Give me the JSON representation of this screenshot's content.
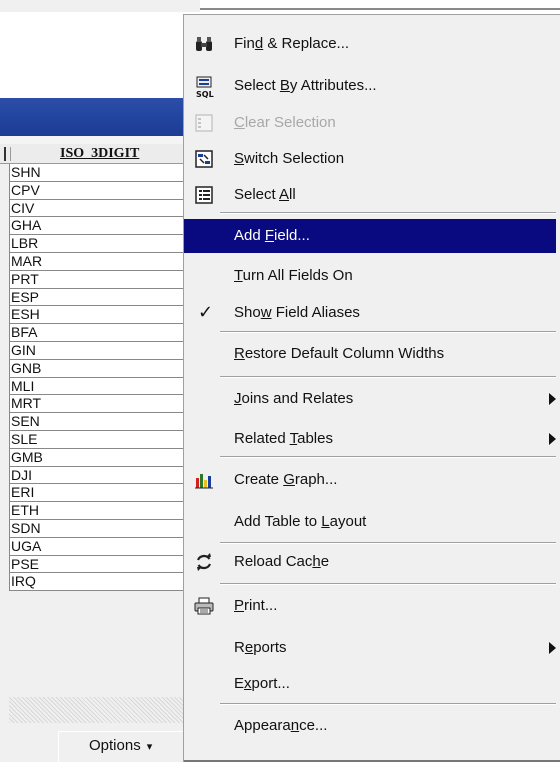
{
  "table": {
    "column_header": "ISO_3DIGIT",
    "rows": [
      "SHN",
      "CPV",
      "CIV",
      "GHA",
      "LBR",
      "MAR",
      "PRT",
      "ESP",
      "ESH",
      "BFA",
      "GIN",
      "GNB",
      "MLI",
      "MRT",
      "SEN",
      "SLE",
      "GMB",
      "DJI",
      "ERI",
      "ETH",
      "SDN",
      "UGA",
      "PSE",
      "IRQ"
    ],
    "options_label": "Options",
    "options_arrow": "▾"
  },
  "menu": {
    "find_replace": {
      "pre": "Fin",
      "key": "d",
      "post": " & Replace..."
    },
    "select_by_attributes": {
      "pre": "Select ",
      "key": "B",
      "post": "y Attributes..."
    },
    "clear_selection": {
      "pre": "",
      "key": "C",
      "post": "lear Selection"
    },
    "switch_selection": {
      "pre": "",
      "key": "S",
      "post": "witch Selection"
    },
    "select_all": {
      "pre": "Select ",
      "key": "A",
      "post": "ll"
    },
    "add_field": {
      "pre": "Add ",
      "key": "F",
      "post": "ield..."
    },
    "turn_all_fields_on": {
      "pre": "",
      "key": "T",
      "post": "urn All Fields On"
    },
    "show_field_aliases": {
      "pre": "Sho",
      "key": "w",
      "post": " Field Aliases"
    },
    "restore_column_widths": {
      "pre": "",
      "key": "R",
      "post": "estore Default Column Widths"
    },
    "joins_and_relates": {
      "pre": "",
      "key": "J",
      "post": "oins and Relates"
    },
    "related_tables": {
      "pre": "Related ",
      "key": "T",
      "post": "ables"
    },
    "create_graph": {
      "pre": "Create ",
      "key": "G",
      "post": "raph..."
    },
    "add_table_to_layout": {
      "pre": "Add Table to ",
      "key": "L",
      "post": "ayout"
    },
    "reload_cache": {
      "pre": "Reload Cac",
      "key": "h",
      "post": "e"
    },
    "print": {
      "pre": "",
      "key": "P",
      "post": "rint..."
    },
    "reports": {
      "pre": "R",
      "key": "e",
      "post": "ports"
    },
    "export": {
      "pre": "E",
      "key": "x",
      "post": "port..."
    },
    "appearance": {
      "pre": "Appeara",
      "key": "n",
      "post": "ce..."
    },
    "checkmark": "✓"
  },
  "colors": {
    "highlight": "#0a0a80",
    "title_bar": "#2346a0"
  }
}
